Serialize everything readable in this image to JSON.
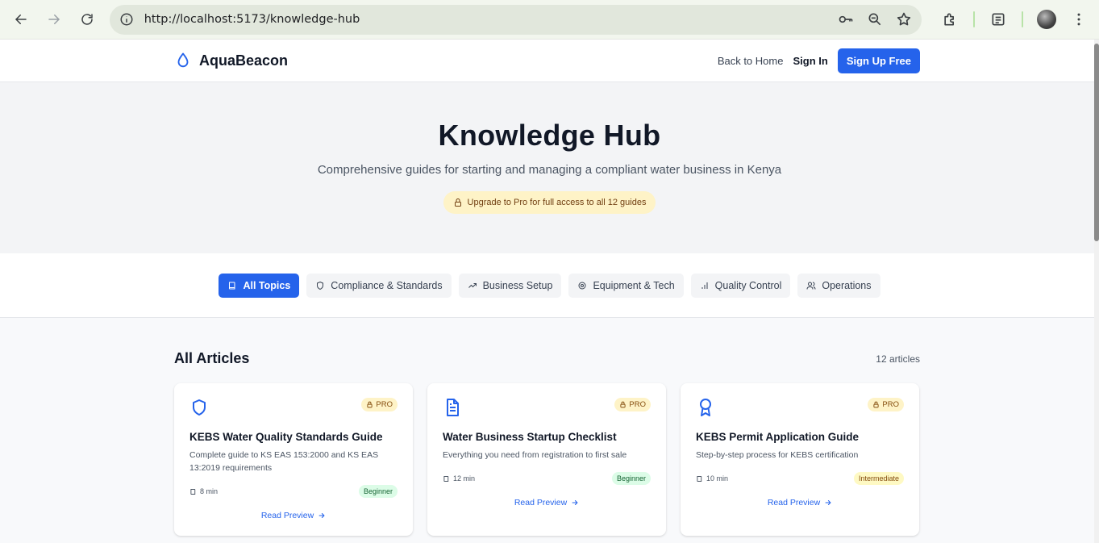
{
  "browser": {
    "url": "http://localhost:5173/knowledge-hub"
  },
  "header": {
    "brand": "AquaBeacon",
    "back_home": "Back to Home",
    "sign_in": "Sign In",
    "sign_up": "Sign Up Free"
  },
  "hero": {
    "title": "Knowledge Hub",
    "subtitle": "Comprehensive guides for starting and managing a compliant water business in Kenya",
    "upgrade": "Upgrade to Pro for full access to all 12 guides"
  },
  "filters": [
    {
      "label": "All Topics",
      "icon": "book-icon",
      "active": true
    },
    {
      "label": "Compliance & Standards",
      "icon": "shield-icon",
      "active": false
    },
    {
      "label": "Business Setup",
      "icon": "trending-up-icon",
      "active": false
    },
    {
      "label": "Equipment & Tech",
      "icon": "gear-icon",
      "active": false
    },
    {
      "label": "Quality Control",
      "icon": "bar-chart-icon",
      "active": false
    },
    {
      "label": "Operations",
      "icon": "users-icon",
      "active": false
    }
  ],
  "articles": {
    "heading": "All Articles",
    "count": "12 articles",
    "items": [
      {
        "icon": "shield-icon",
        "badge": "PRO",
        "title": "KEBS Water Quality Standards Guide",
        "description": "Complete guide to KS EAS 153:2000 and KS EAS 13:2019 requirements",
        "read_time": "8 min",
        "level": "Beginner",
        "cta": "Read Preview"
      },
      {
        "icon": "document-icon",
        "badge": "PRO",
        "title": "Water Business Startup Checklist",
        "description": "Everything you need from registration to first sale",
        "read_time": "12 min",
        "level": "Beginner",
        "cta": "Read Preview"
      },
      {
        "icon": "award-icon",
        "badge": "PRO",
        "title": "KEBS Permit Application Guide",
        "description": "Step-by-step process for KEBS certification",
        "read_time": "10 min",
        "level": "Intermediate",
        "cta": "Read Preview"
      }
    ]
  },
  "colors": {
    "accent": "#2563eb",
    "pro_badge_bg": "#fef3c7",
    "beginner_bg": "#dcfce7",
    "intermediate_bg": "#fef9c3"
  }
}
